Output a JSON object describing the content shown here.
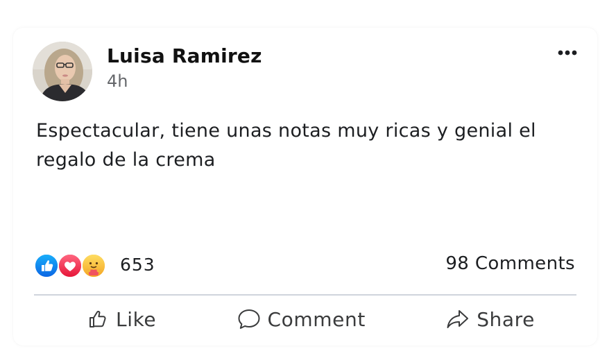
{
  "post": {
    "author": "Luisa Ramirez",
    "time": "4h",
    "text": "Espectacular, tiene unas notas muy ricas y genial el regalo de la crema",
    "reactions": {
      "icons": [
        "like-icon",
        "love-icon",
        "care-icon"
      ],
      "count": "653"
    },
    "comments_count": "98 Comments"
  },
  "actions": {
    "like_label": "Like",
    "comment_label": "Comment",
    "share_label": "Share"
  },
  "colors": {
    "like_blue": "#1877f2",
    "love_red": "#f02849",
    "care_yellow": "#f7b125",
    "muted_text": "#65676b",
    "divider": "#cfd4dc"
  }
}
